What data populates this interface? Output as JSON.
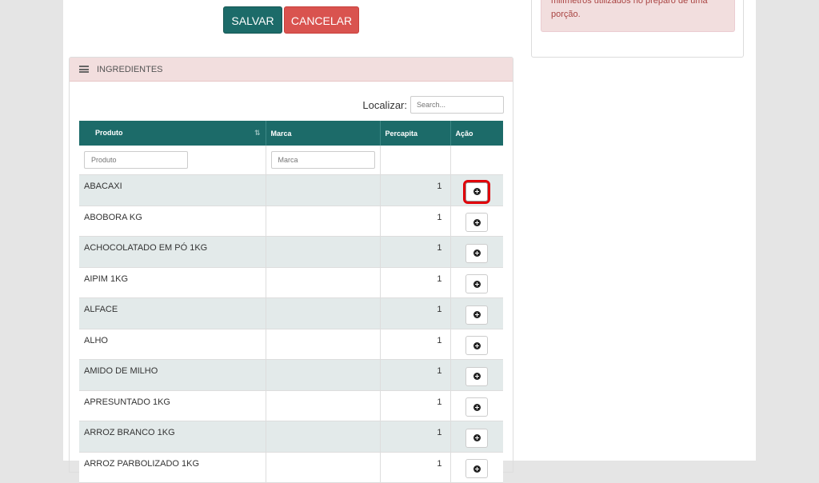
{
  "form": {
    "save_label": "SALVAR",
    "cancel_label": "CANCELAR"
  },
  "alert": {
    "text": "milímetros utilizados no preparo de uma porção."
  },
  "panel": {
    "title": "INGREDIENTES",
    "search_label": "Localizar:",
    "search_placeholder": "Search..."
  },
  "table": {
    "headers": [
      "Produto",
      "Marca",
      "Percapita",
      "Ação"
    ],
    "filter_produto_placeholder": "Produto",
    "filter_marca_placeholder": "Marca",
    "rows": [
      {
        "produto": "ABACAXI",
        "marca": "",
        "percapita": "1"
      },
      {
        "produto": "ABOBORA KG",
        "marca": "",
        "percapita": "1"
      },
      {
        "produto": "ACHOCOLATADO EM PÓ 1KG",
        "marca": "",
        "percapita": "1"
      },
      {
        "produto": "AIPIM 1KG",
        "marca": "",
        "percapita": "1"
      },
      {
        "produto": "ALFACE",
        "marca": "",
        "percapita": "1"
      },
      {
        "produto": "ALHO",
        "marca": "",
        "percapita": "1"
      },
      {
        "produto": "AMIDO DE MILHO",
        "marca": "",
        "percapita": "1"
      },
      {
        "produto": "APRESUNTADO 1KG",
        "marca": "",
        "percapita": "1"
      },
      {
        "produto": "ARROZ BRANCO 1KG",
        "marca": "",
        "percapita": "1"
      },
      {
        "produto": "ARROZ PARBOLIZADO 1KG",
        "marca": "",
        "percapita": "1"
      }
    ]
  },
  "colors": {
    "header_teal": "#1c6b69",
    "cancel_red": "#d9534f",
    "panel_head": "#f2dede",
    "highlight": "#e0000a"
  }
}
